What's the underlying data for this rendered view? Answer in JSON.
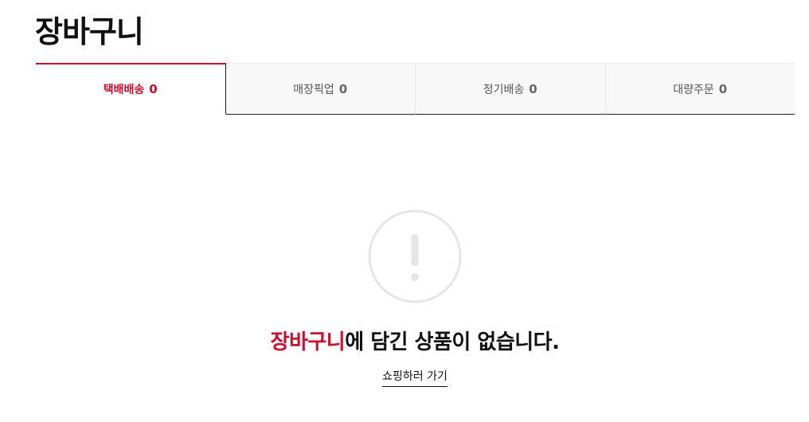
{
  "page": {
    "title": "장바구니"
  },
  "tabs": [
    {
      "label": "택배배송",
      "count": "0",
      "active": true
    },
    {
      "label": "매장픽업",
      "count": "0",
      "active": false
    },
    {
      "label": "정기배송",
      "count": "0",
      "active": false
    },
    {
      "label": "대량주문",
      "count": "0",
      "active": false
    }
  ],
  "empty_state": {
    "icon": "exclamation-circle-icon",
    "message_highlight": "장바구니",
    "message_rest": "에 담긴 상품이 없습니다.",
    "link_label": "쇼핑하러 가기"
  },
  "colors": {
    "accent": "#c8102e",
    "icon_gray": "#e6e6e6",
    "tab_bg": "#f8f8f8"
  }
}
